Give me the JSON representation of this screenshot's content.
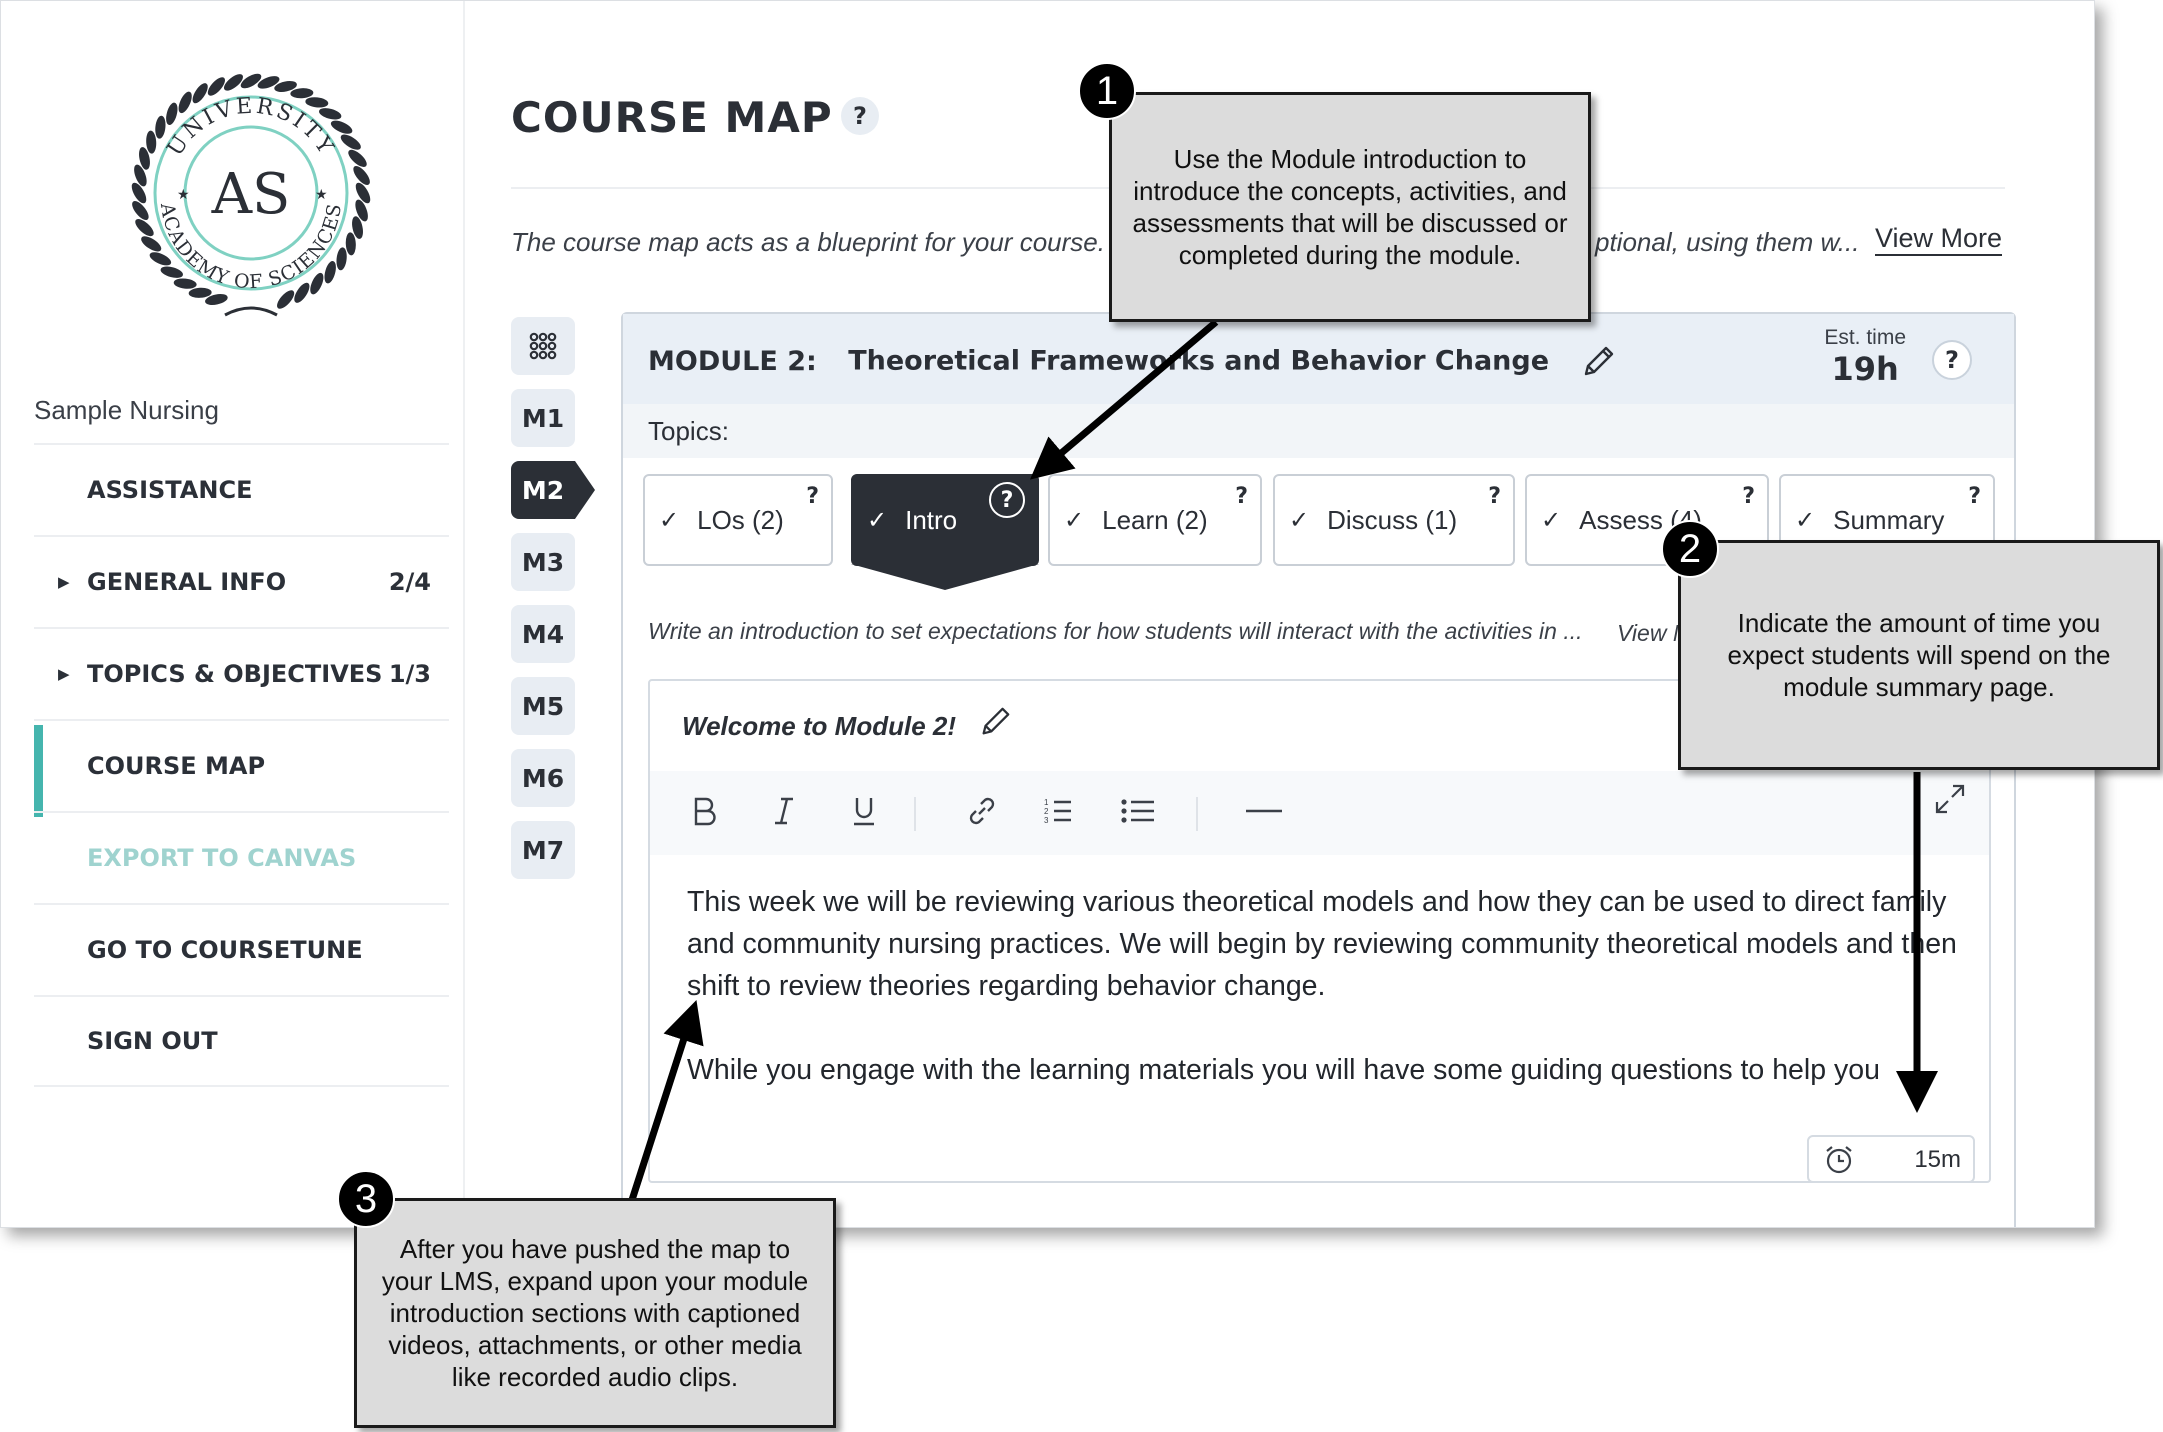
{
  "sidebar": {
    "course_name": "Sample Nursing",
    "logo": {
      "initials": "AS",
      "ring_text_top": "UNIVERSITY",
      "ring_text_bottom": "ACADEMY OF SCIENCES"
    },
    "items": [
      {
        "label": "ASSISTANCE",
        "count": "",
        "expandable": false,
        "state": "normal"
      },
      {
        "label": "GENERAL INFO",
        "count": "2/4",
        "expandable": true,
        "state": "normal"
      },
      {
        "label": "TOPICS & OBJECTIVES",
        "count": "1/3",
        "expandable": true,
        "state": "normal"
      },
      {
        "label": "COURSE MAP",
        "count": "",
        "expandable": false,
        "state": "active"
      },
      {
        "label": "EXPORT TO CANVAS",
        "count": "",
        "expandable": false,
        "state": "disabled"
      },
      {
        "label": "GO TO COURSETUNE",
        "count": "",
        "expandable": false,
        "state": "normal"
      },
      {
        "label": "SIGN OUT",
        "count": "",
        "expandable": false,
        "state": "normal"
      }
    ]
  },
  "header": {
    "title": "COURSE MAP",
    "help_symbol": "?",
    "intro_text": "The course map acts as a blueprint for your course.",
    "intro_text_tail": "ptional, using them w...",
    "view_more": "View More"
  },
  "module_nav": {
    "grid_icon": "grid-icon",
    "modules": [
      "M1",
      "M2",
      "M3",
      "M4",
      "M5",
      "M6",
      "M7"
    ],
    "active": "M2"
  },
  "module": {
    "label": "MODULE 2:",
    "title": "Theoretical Frameworks and Behavior Change",
    "est_label": "Est. time",
    "est_value": "19h",
    "topics_label": "Topics:",
    "tabs": [
      {
        "label": "LOs (2)",
        "check": "✓",
        "help": "?",
        "active": false
      },
      {
        "label": "Intro",
        "check": "✓",
        "help": "?",
        "active": true
      },
      {
        "label": "Learn (2)",
        "check": "✓",
        "help": "?",
        "active": false
      },
      {
        "label": "Discuss (1)",
        "check": "✓",
        "help": "?",
        "active": false
      },
      {
        "label": "Assess (4)",
        "check": "✓",
        "help": "?",
        "active": false
      },
      {
        "label": "Summary",
        "check": "✓",
        "help": "?",
        "active": false
      }
    ],
    "topic_description": "Write an introduction to set expectations for how students will interact with the activities in ...",
    "topic_view": "View M"
  },
  "editor": {
    "title": "Welcome to Module 2!",
    "toolbar": [
      "bold-icon",
      "italic-icon",
      "underline-icon",
      "link-icon",
      "numbered-list-icon",
      "bulleted-list-icon",
      "horizontal-rule-icon",
      "expand-icon"
    ],
    "paragraphs": [
      "This week we will be reviewing various theoretical models and how they can be used to direct family and community nursing practices. We will begin by reviewing community theoretical models and then shift to review theories regarding behavior change.",
      "While you engage with the learning materials you will have some guiding questions to help you"
    ],
    "time_value": "15m"
  },
  "callouts": [
    {
      "number": "1",
      "text": "Use the Module introduction to introduce the concepts, activities, and assessments that will be discussed or completed during the module."
    },
    {
      "number": "2",
      "text": "Indicate the amount of time you expect students will spend on the module summary page."
    },
    {
      "number": "3",
      "text": "After you have pushed the map to your LMS, expand upon your module introduction sections with captioned videos, attachments, or other media like recorded audio clips."
    }
  ],
  "colors": {
    "accent_teal": "#45b5ae",
    "dark": "#2b2f36",
    "panel_header": "#e9eff6",
    "callout_fill": "#dcdcdc"
  }
}
